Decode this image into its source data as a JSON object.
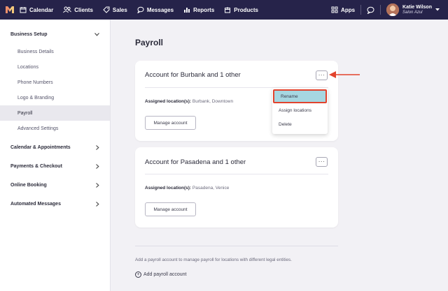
{
  "nav": {
    "items": [
      {
        "label": "Calendar",
        "icon": "calendar-icon"
      },
      {
        "label": "Clients",
        "icon": "clients-icon"
      },
      {
        "label": "Sales",
        "icon": "tag-icon"
      },
      {
        "label": "Messages",
        "icon": "chat-icon"
      },
      {
        "label": "Reports",
        "icon": "chart-icon"
      },
      {
        "label": "Products",
        "icon": "box-icon"
      }
    ],
    "apps_label": "Apps",
    "user": {
      "name": "Katie Wilson",
      "salon": "Salon Azul"
    }
  },
  "sidebar": {
    "business_setup": "Business Setup",
    "items": [
      "Business Details",
      "Locations",
      "Phone Numbers",
      "Logo & Branding",
      "Payroll",
      "Advanced Settings"
    ],
    "active_item": "Payroll",
    "sections": [
      "Calendar & Appointments",
      "Payments & Checkout",
      "Online Booking",
      "Automated Messages"
    ]
  },
  "main": {
    "title": "Payroll",
    "cards": [
      {
        "title": "Account for Burbank and 1 other",
        "loc_label": "Assigned location(s):",
        "locations": "Burbank, Downtown",
        "button": "Manage account",
        "more": "···"
      },
      {
        "title": "Account for Pasadena and 1 other",
        "loc_label": "Assigned location(s):",
        "locations": "Pasadena, Venice",
        "button": "Manage account",
        "more": "···"
      }
    ],
    "menu": {
      "items": [
        "Rename",
        "Assign locations",
        "Delete"
      ],
      "highlighted": "Rename"
    },
    "help_text": "Add a payroll account to manage payroll for locations with different legal entities.",
    "add_label": "Add payroll account"
  },
  "colors": {
    "nav_bg": "#26234a",
    "highlight": "#a6d7e1",
    "annotation": "#e2432d"
  }
}
